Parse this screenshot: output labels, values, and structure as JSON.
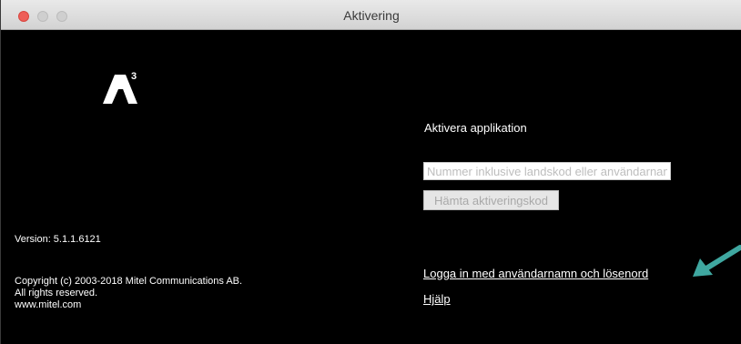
{
  "window": {
    "title": "Aktivering"
  },
  "logo": {
    "icon": "a3-logo-icon"
  },
  "info": {
    "version": "Version: 5.1.1.6121",
    "copyright_line1": "Copyright (c) 2003-2018 Mitel Communications AB.",
    "copyright_line2": "All rights reserved.",
    "copyright_line3": "www.mitel.com"
  },
  "activation": {
    "title": "Aktivera applikation",
    "input_placeholder": "Nummer inklusive landskod eller användarnamn",
    "input_value": "",
    "fetch_button_label": "Hämta aktiveringskod"
  },
  "links": {
    "login": "Logga in med användarnamn och lösenord",
    "help": "Hjälp"
  },
  "annotation": {
    "icon": "arrow-icon",
    "color": "#3fa7a0"
  },
  "colors": {
    "background": "#000000",
    "text": "#ffffff",
    "close_button": "#ee5e58"
  }
}
